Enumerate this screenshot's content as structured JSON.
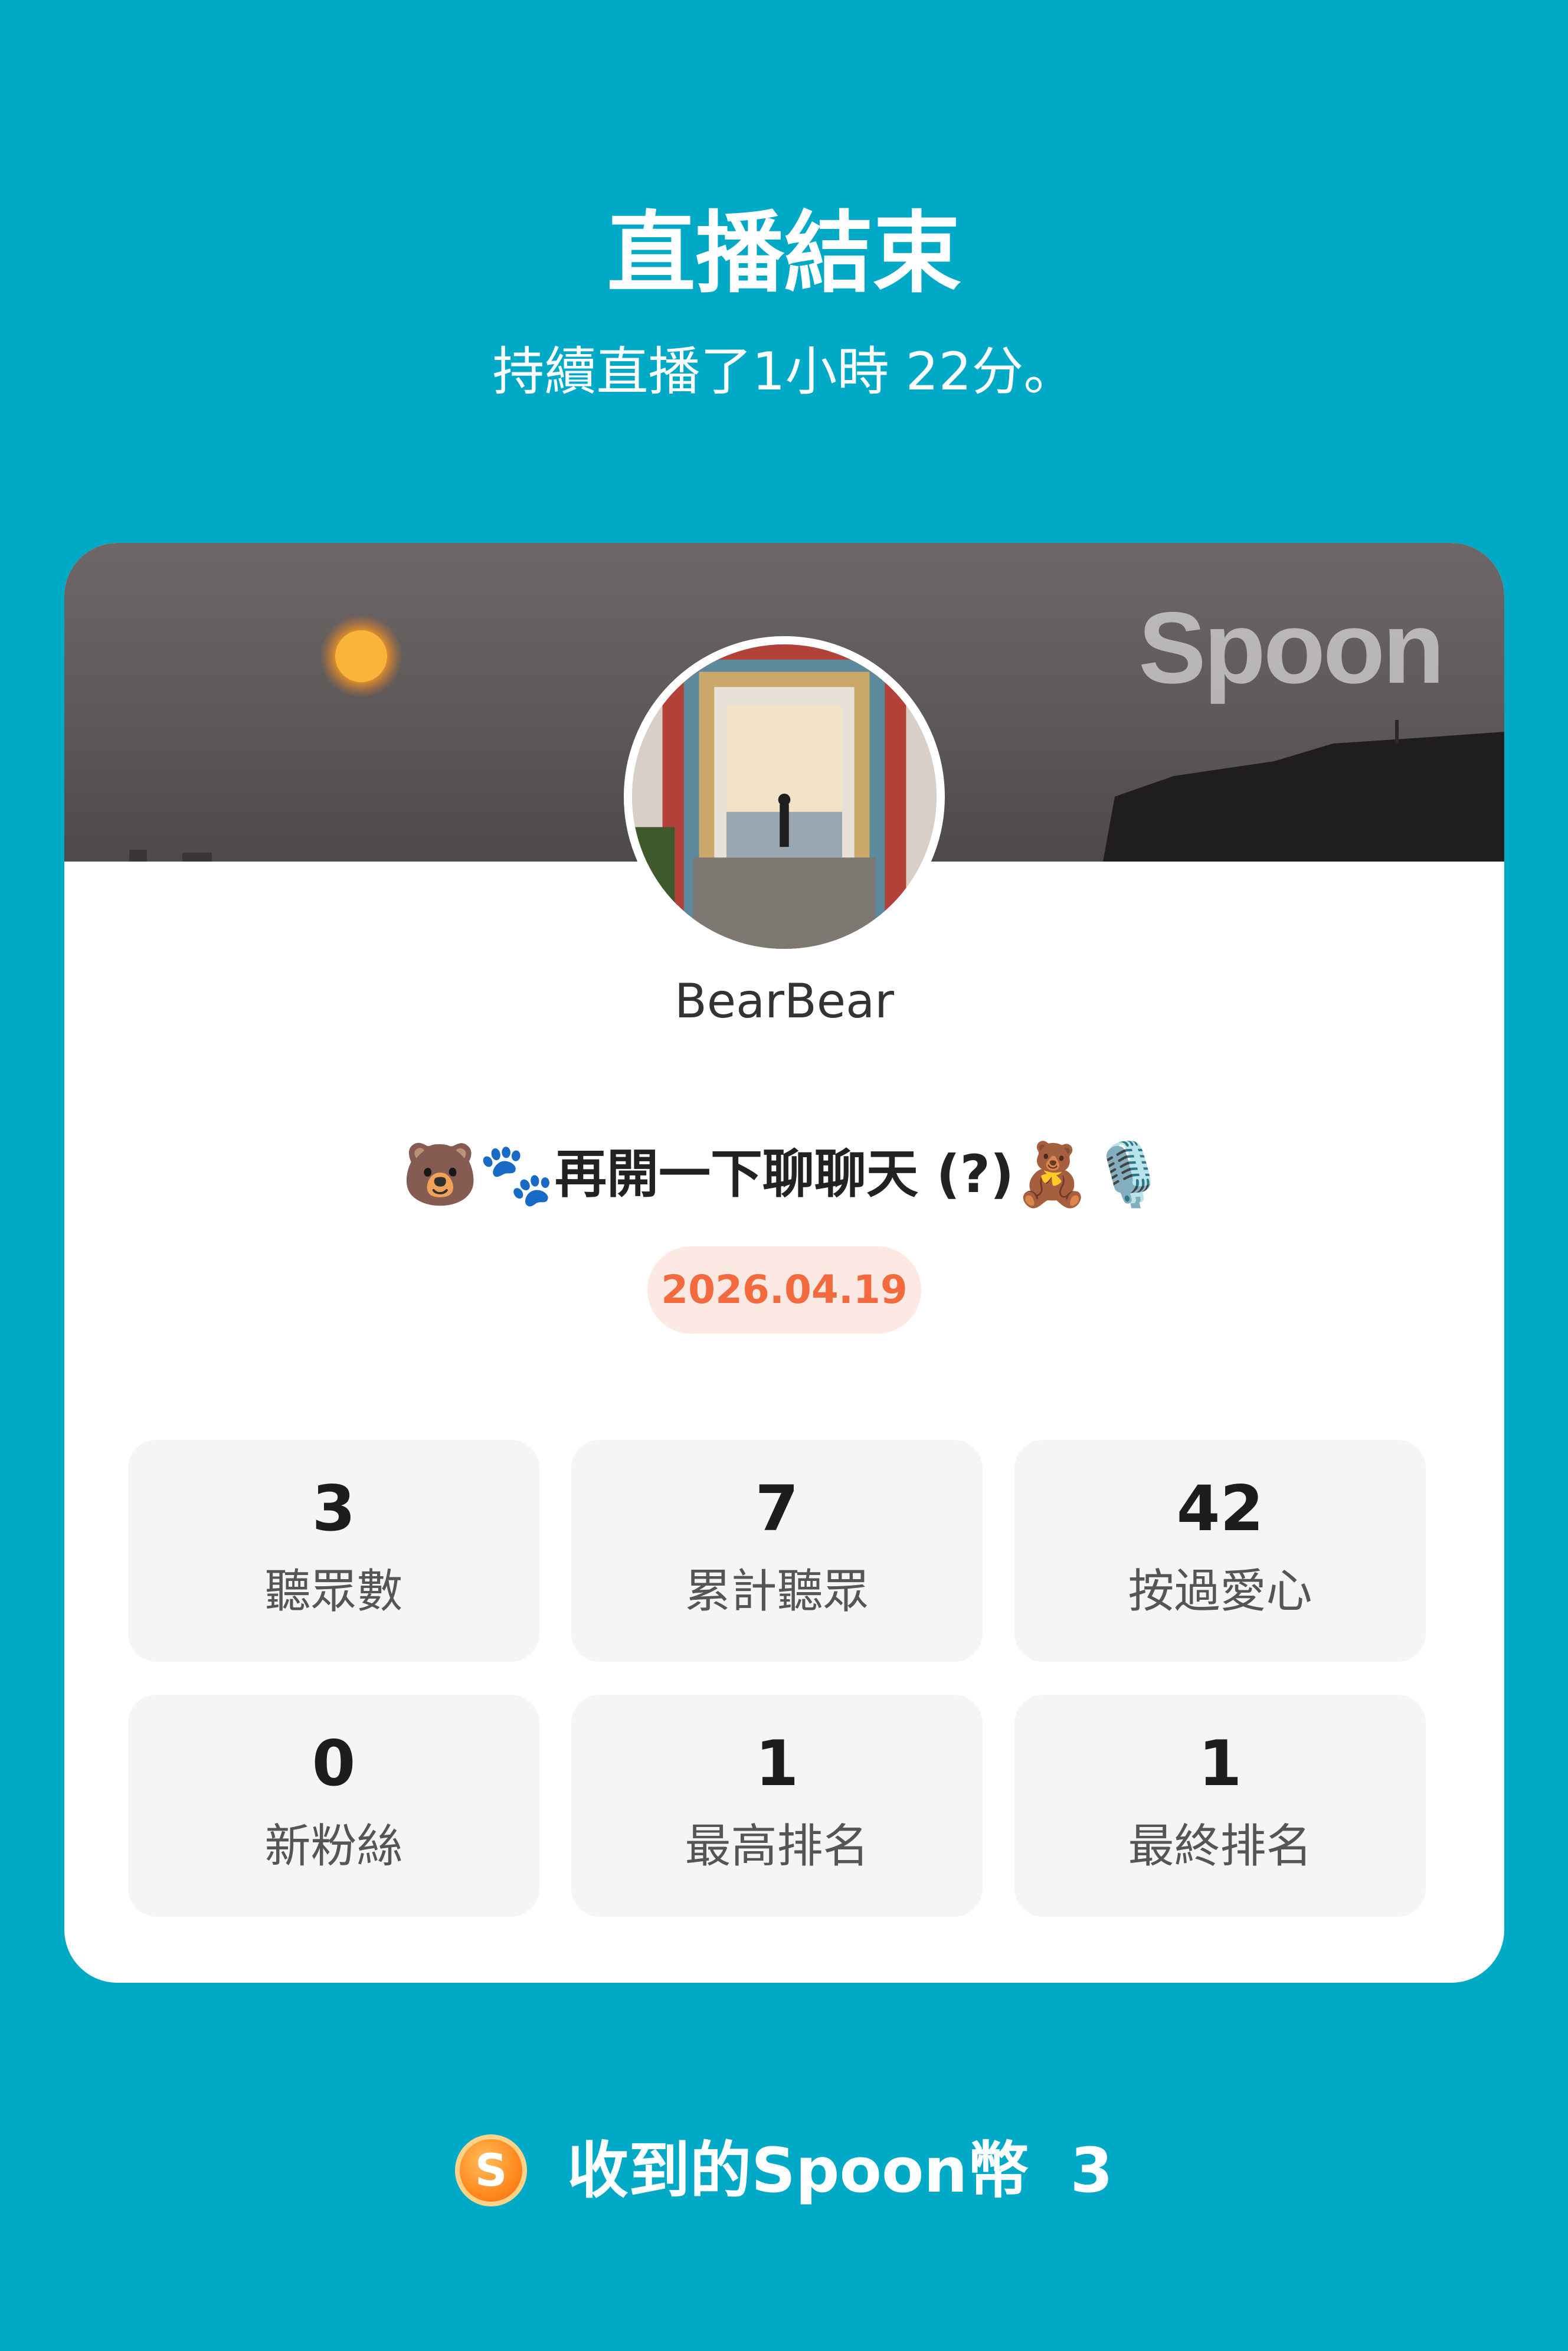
{
  "header": {
    "title": "直播結束",
    "subtitle": "持續直播了1小時 22分。"
  },
  "card": {
    "brand_logo": "Spoon",
    "username": "BearBear",
    "live_title": "再開一下聊聊天 (?)",
    "title_emojis": {
      "bear_face": "🐻",
      "paws": "🐾",
      "teddy": "🧸",
      "microphone": "🎙️"
    },
    "date": "2026.04.19"
  },
  "stats": [
    {
      "value": "3",
      "label": "聽眾數"
    },
    {
      "value": "7",
      "label": "累計聽眾"
    },
    {
      "value": "42",
      "label": "按過愛心"
    },
    {
      "value": "0",
      "label": "新粉絲"
    },
    {
      "value": "1",
      "label": "最高排名"
    },
    {
      "value": "1",
      "label": "最終排名"
    }
  ],
  "coins": {
    "icon_letter": "S",
    "label": "收到的Spoon幣",
    "value": "3"
  },
  "colors": {
    "background": "#00aac6",
    "date_text": "#f26a3d",
    "date_bg": "#fde9e3",
    "coin": "#ff8a1f"
  }
}
